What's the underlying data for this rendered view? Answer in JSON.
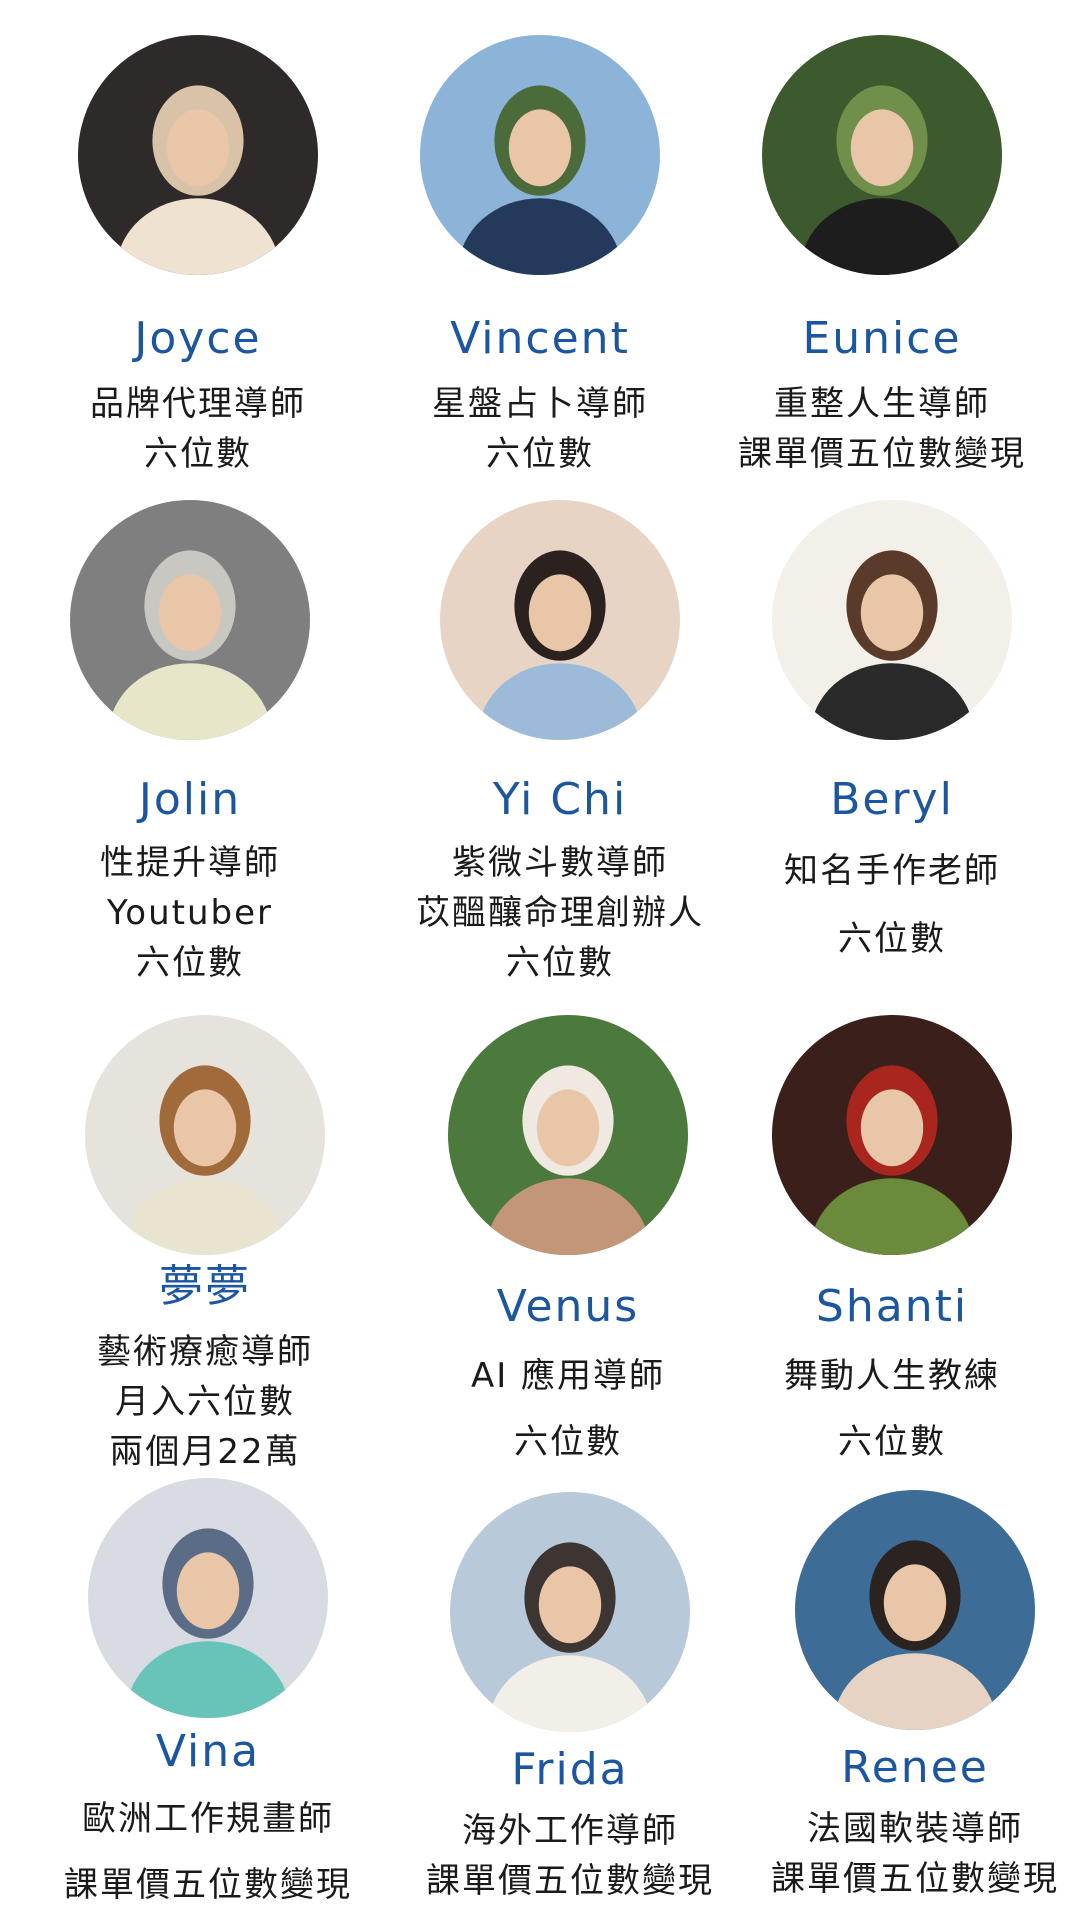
{
  "mentors": [
    {
      "name": "Joyce",
      "lines": [
        "品牌代理導師",
        "六位數"
      ],
      "icon": "portrait-photo",
      "colors": [
        "#2e2a2a",
        "#d9c3a8",
        "#f0e2d0"
      ]
    },
    {
      "name": "Vincent",
      "lines": [
        "星盤占卜導師",
        "六位數"
      ],
      "icon": "portrait-photo",
      "colors": [
        "#8cb4d9",
        "#4c6b3a",
        "#243a5c"
      ]
    },
    {
      "name": "Eunice",
      "lines": [
        "重整人生導師",
        "課單價五位數變現"
      ],
      "icon": "portrait-photo",
      "colors": [
        "#3d5a2e",
        "#6f8f4a",
        "#1d1d1d"
      ]
    },
    {
      "name": "Jolin",
      "lines": [
        "性提升導師",
        "Youtuber",
        "六位數"
      ],
      "icon": "portrait-photo",
      "colors": [
        "#7f7f7f",
        "#c9c7c2",
        "#e8e6c8"
      ]
    },
    {
      "name": "Yi Chi",
      "lines": [
        "紫微斗數導師",
        "苡醞釀命理創辦人",
        "六位數"
      ],
      "icon": "portrait-photo",
      "colors": [
        "#e8d4c5",
        "#2b2220",
        "#9dbbd8"
      ]
    },
    {
      "name": "Beryl",
      "lines": [
        "知名手作老師",
        "六位數"
      ],
      "icon": "portrait-photo",
      "colors": [
        "#f3efe9",
        "#5a3a28",
        "#2a2a2a"
      ]
    },
    {
      "name": "夢夢",
      "lines": [
        "藝術療癒導師",
        "月入六位數",
        "兩個月22萬"
      ],
      "icon": "portrait-photo",
      "colors": [
        "#e6e2dc",
        "#a16a3a",
        "#e9e4cf"
      ]
    },
    {
      "name": "Venus",
      "lines": [
        "AI 應用導師",
        "六位數"
      ],
      "icon": "portrait-photo",
      "colors": [
        "#4c7a3c",
        "#efe9e2",
        "#c49678"
      ]
    },
    {
      "name": "Shanti",
      "lines": [
        "舞動人生教練",
        "六位數"
      ],
      "icon": "portrait-photo",
      "colors": [
        "#3a1f1a",
        "#a8261e",
        "#6b8a3c"
      ]
    },
    {
      "name": "Vina",
      "lines": [
        "歐洲工作規畫師",
        "課單價五位數變現"
      ],
      "icon": "portrait-photo",
      "colors": [
        "#d9dbe3",
        "#5b6c86",
        "#68c3b8"
      ]
    },
    {
      "name": "Frida",
      "lines": [
        "海外工作導師",
        "課單價五位數變現"
      ],
      "icon": "portrait-photo",
      "colors": [
        "#b8c9d9",
        "#3d3531",
        "#f2efe9"
      ]
    },
    {
      "name": "Renee",
      "lines": [
        "法國軟裝導師",
        "課單價五位數變現"
      ],
      "icon": "portrait-photo",
      "colors": [
        "#3d6d96",
        "#2a2320",
        "#e7d3c3"
      ]
    }
  ],
  "accent": "#1c56a0",
  "text_color": "#1a1a1a"
}
